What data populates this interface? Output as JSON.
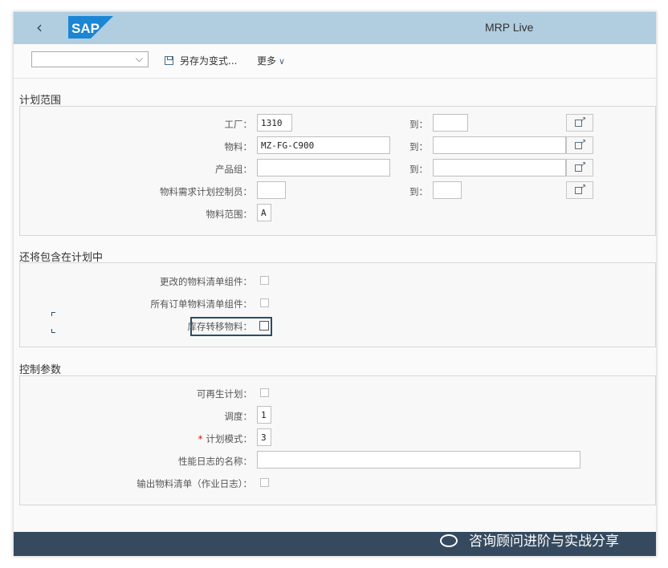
{
  "app": {
    "title": "MRP Live",
    "logo_text": "SAP"
  },
  "toolbar": {
    "variant_value": "",
    "save_as_variant": "另存为变式...",
    "more": "更多"
  },
  "sections": {
    "planning_scope": {
      "title": "计划范围",
      "plant_label": "工厂：",
      "plant_value": "1310",
      "material_label": "物料：",
      "material_value": "MZ-FG-C900",
      "product_group_label": "产品组：",
      "product_group_value": "",
      "mrp_controller_label": "物料需求计划控制员：",
      "mrp_controller_value": "",
      "material_scope_label": "物料范围：",
      "material_scope_value": "A",
      "to_label": "到："
    },
    "also_include": {
      "title": "还将包含在计划中",
      "changed_bom_label": "更改的物料清单组件：",
      "order_bom_label": "所有订单物料清单组件：",
      "stock_transfer_label": "库存转移物料："
    },
    "control_params": {
      "title": "控制参数",
      "regenerative_label": "可再生计划：",
      "scheduling_label": "调度：",
      "scheduling_value": "1",
      "planning_mode_label": "计划模式：",
      "planning_mode_value": "3",
      "required_mark": "*",
      "perf_log_label": "性能日志的名称：",
      "perf_log_value": "",
      "output_bom_label": "输出物料清单（作业日志）："
    }
  },
  "watermark": "咨询顾问进阶与实战分享",
  "colors": {
    "shell": "#b1cde0",
    "footer": "#354a5f",
    "focus": "#2b4d67",
    "required": "#dd0000"
  }
}
